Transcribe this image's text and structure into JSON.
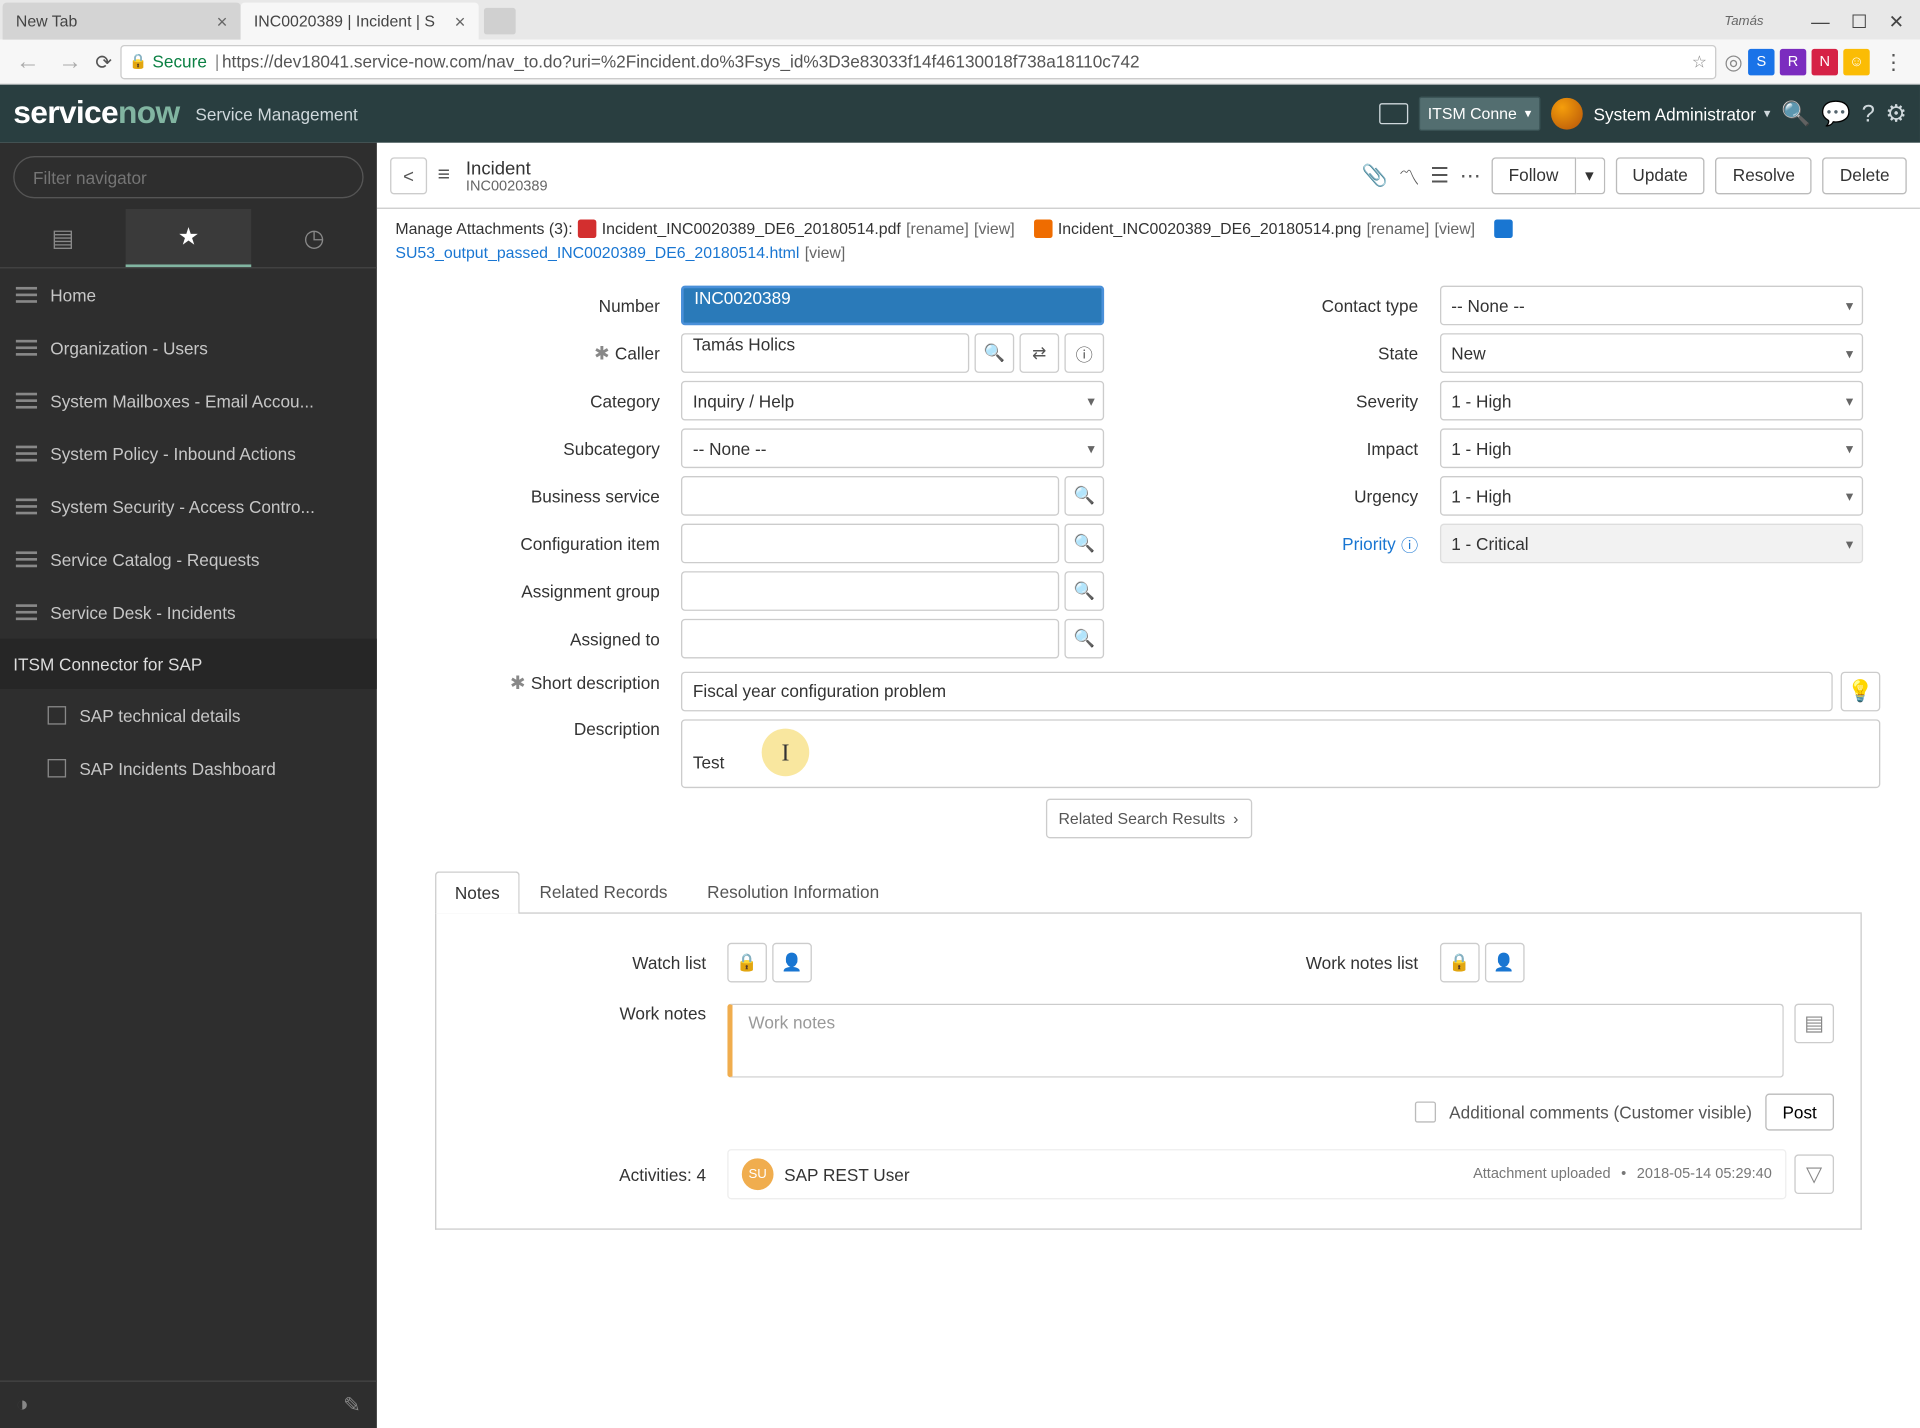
{
  "browser": {
    "tabs": [
      {
        "label": "New Tab"
      },
      {
        "label": "INC0020389 | Incident | S"
      }
    ],
    "username": "Tamás",
    "secure": "Secure",
    "url": "https://dev18041.service-now.com/nav_to.do?uri=%2Fincident.do%3Fsys_id%3D3e83033f14f46130018f738a18110c742"
  },
  "banner": {
    "title_a": "service",
    "title_b": "now",
    "subtitle": "Service Management",
    "role": "ITSM Conne",
    "user": "System Administrator"
  },
  "sidebar": {
    "filter_placeholder": "Filter navigator",
    "items": [
      "Home",
      "Organization - Users",
      "System Mailboxes - Email Accou...",
      "System Policy - Inbound Actions",
      "System Security - Access Contro...",
      "Service Catalog - Requests",
      "Service Desk - Incidents"
    ],
    "section_header": "ITSM Connector for SAP",
    "sub_items": [
      "SAP technical details",
      "SAP Incidents Dashboard"
    ]
  },
  "header": {
    "title": "Incident",
    "subtitle": "INC0020389",
    "follow": "Follow",
    "update": "Update",
    "resolve": "Resolve",
    "delete": "Delete"
  },
  "attachments": {
    "lead": "Manage Attachments (3):",
    "files": [
      {
        "name": "Incident_INC0020389_DE6_20180514.pdf",
        "type": "pdf"
      },
      {
        "name": "Incident_INC0020389_DE6_20180514.png",
        "type": "img"
      },
      {
        "name": "SU53_output_passed_INC0020389_DE6_20180514.html",
        "type": "htm"
      }
    ],
    "rename": "[rename]",
    "view": "[view]"
  },
  "fields": {
    "number_lbl": "Number",
    "number": "INC0020389",
    "caller_lbl": "Caller",
    "caller": "Tamás Holics",
    "category_lbl": "Category",
    "category": "Inquiry / Help",
    "subcategory_lbl": "Subcategory",
    "subcategory": "-- None --",
    "bservice_lbl": "Business service",
    "bservice": "",
    "ci_lbl": "Configuration item",
    "ci": "",
    "agroup_lbl": "Assignment group",
    "agroup": "",
    "ato_lbl": "Assigned to",
    "ato": "",
    "contact_lbl": "Contact type",
    "contact": "-- None --",
    "state_lbl": "State",
    "state": "New",
    "severity_lbl": "Severity",
    "severity": "1 - High",
    "impact_lbl": "Impact",
    "impact": "1 - High",
    "urgency_lbl": "Urgency",
    "urgency": "1 - High",
    "priority_lbl": "Priority",
    "priority": "1 - Critical",
    "sdesc_lbl": "Short description",
    "sdesc": "Fiscal year configuration problem",
    "desc_lbl": "Description",
    "desc": "Test"
  },
  "related": "Related Search Results",
  "tabs": {
    "notes": "Notes",
    "related": "Related Records",
    "resolution": "Resolution Information"
  },
  "notes": {
    "watch_lbl": "Watch list",
    "wnlist_lbl": "Work notes list",
    "wn_lbl": "Work notes",
    "wn_ph": "Work notes",
    "addl": "Additional comments (Customer visible)",
    "post": "Post",
    "act_lbl": "Activities: 4",
    "actor_initials": "SU",
    "actor": "SAP REST User",
    "act_type": "Attachment uploaded",
    "act_time": "2018-05-14 05:29:40"
  }
}
